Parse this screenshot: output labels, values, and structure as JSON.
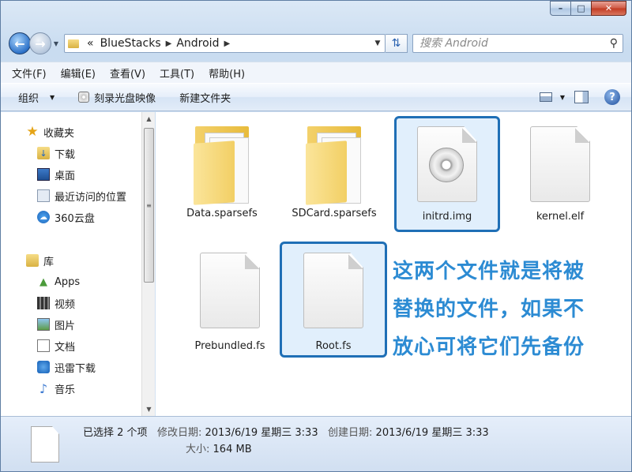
{
  "window": {
    "caption_min": "–",
    "caption_max": "□",
    "caption_close": "✕"
  },
  "address": {
    "prefix": "«",
    "crumbs": [
      "BlueStacks",
      "Android"
    ],
    "search_placeholder": "搜索 Android"
  },
  "menu": [
    "文件(F)",
    "编辑(E)",
    "查看(V)",
    "工具(T)",
    "帮助(H)"
  ],
  "toolbar": {
    "organize": "组织",
    "burn": "刻录光盘映像",
    "new_folder": "新建文件夹",
    "help": "?"
  },
  "nav": {
    "favorites": "收藏夹",
    "downloads": "下载",
    "desktop": "桌面",
    "recent": "最近访问的位置",
    "cloud": "360云盘",
    "library": "库",
    "apps": "Apps",
    "videos": "视频",
    "pictures": "图片",
    "documents": "文档",
    "xunlei": "迅雷下载",
    "music": "音乐"
  },
  "files": [
    {
      "name": "Data.sparsefs",
      "type": "folder"
    },
    {
      "name": "SDCard.sparsefs",
      "type": "folder"
    },
    {
      "name": "initrd.img",
      "type": "image",
      "selected": true
    },
    {
      "name": "kernel.elf",
      "type": "file"
    },
    {
      "name": "Prebundled.fs",
      "type": "file"
    },
    {
      "name": "Root.fs",
      "type": "file",
      "selected": true
    }
  ],
  "annotation": [
    "这两个文件就是将被",
    "替换的文件，如果不",
    "放心可将它们先备份"
  ],
  "details": {
    "selected": "已选择 2 个项",
    "modified_label": "修改日期:",
    "modified_value": "2013/6/19 星期三 3:33",
    "created_label": "创建日期:",
    "created_value": "2013/6/19 星期三 3:33",
    "size_label": "大小:",
    "size_value": "164 MB"
  },
  "colors": {
    "selection_border": "#1f6fb6",
    "annotation_text": "#2c8bd3"
  }
}
